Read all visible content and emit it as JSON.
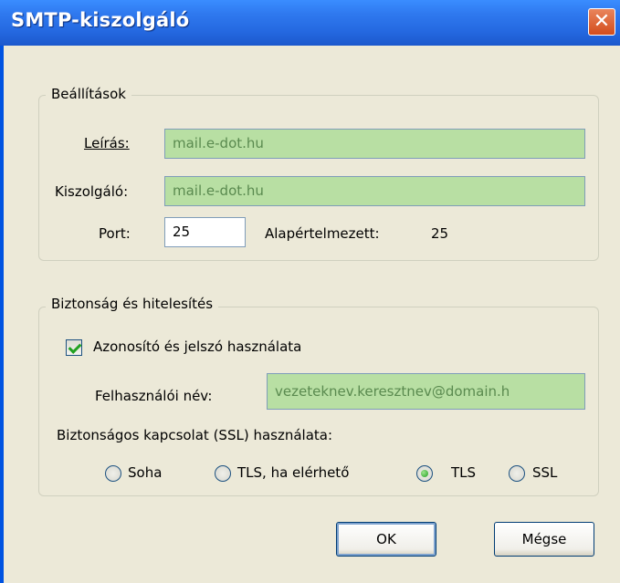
{
  "window": {
    "title": "SMTP-kiszolgáló",
    "close_glyph": "✕"
  },
  "settings_group": {
    "legend": "Beállítások",
    "description_label": "Leírás:",
    "description_value": "mail.e-dot.hu",
    "server_label": "Kiszolgáló:",
    "server_value": "mail.e-dot.hu",
    "port_label": "Port:",
    "port_value": "25",
    "default_label": "Alapértelmezett:",
    "default_value": "25"
  },
  "security_group": {
    "legend": "Biztonság és hitelesítés",
    "use_credentials_label": "Azonosító és jelszó használata",
    "use_credentials_checked": true,
    "username_label": "Felhasználói név:",
    "username_value": "vezeteknev.keresztnev@domain.h",
    "ssl_label": "Biztonságos kapcsolat (SSL) használata:",
    "ssl_options": [
      {
        "label": "Soha",
        "selected": false
      },
      {
        "label": "TLS, ha elérhető",
        "selected": false
      },
      {
        "label": "TLS",
        "selected": true
      },
      {
        "label": "SSL",
        "selected": false
      }
    ]
  },
  "buttons": {
    "ok": "OK",
    "cancel": "Mégse"
  },
  "colors": {
    "titlebar": "#2468e0",
    "dialog_bg": "#ece9d8",
    "prefilled_field": "#b8dfa3",
    "checkmark": "#21a121"
  }
}
